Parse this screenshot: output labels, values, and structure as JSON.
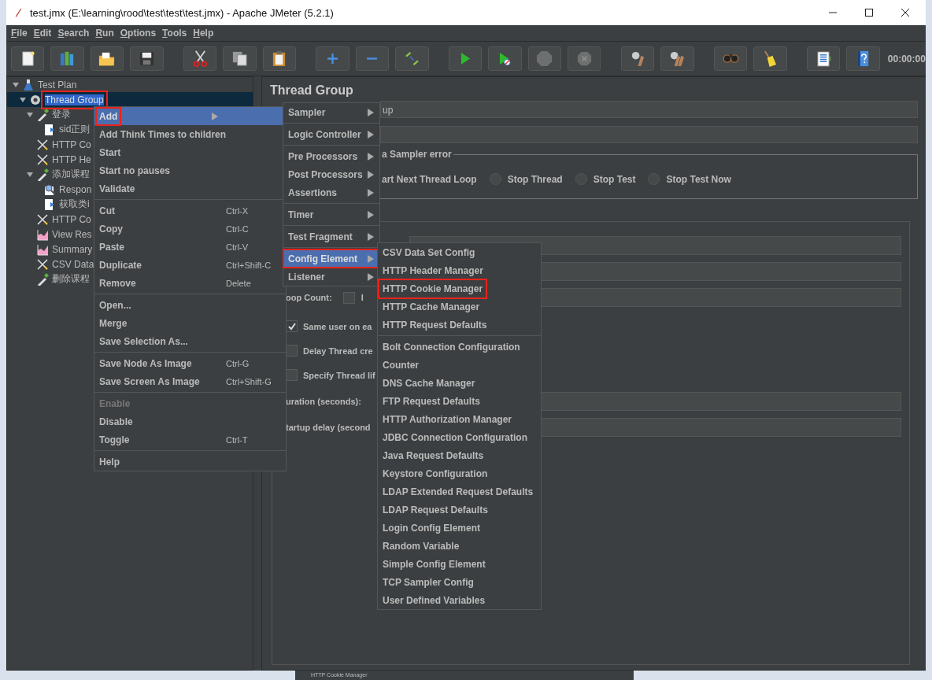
{
  "window": {
    "title": "test.jmx (E:\\learning\\rood\\test\\test\\test.jmx) - Apache JMeter (5.2.1)"
  },
  "menu_bar": [
    {
      "label": "File"
    },
    {
      "label": "Edit"
    },
    {
      "label": "Search"
    },
    {
      "label": "Run"
    },
    {
      "label": "Options"
    },
    {
      "label": "Tools"
    },
    {
      "label": "Help"
    }
  ],
  "toolbar": {
    "buttons": [
      {
        "kind": "new",
        "disabled": false,
        "separator_before": false
      },
      {
        "kind": "templates",
        "disabled": false,
        "separator_before": false
      },
      {
        "kind": "open",
        "disabled": false,
        "separator_before": false
      },
      {
        "kind": "save",
        "disabled": false,
        "separator_before": false
      },
      {
        "kind": "cut",
        "disabled": false,
        "separator_before": true
      },
      {
        "kind": "copy",
        "disabled": false,
        "separator_before": false
      },
      {
        "kind": "paste",
        "disabled": false,
        "separator_before": false
      },
      {
        "kind": "expand",
        "disabled": false,
        "separator_before": true
      },
      {
        "kind": "collapse",
        "disabled": false,
        "separator_before": false
      },
      {
        "kind": "toggle",
        "disabled": false,
        "separator_before": false
      },
      {
        "kind": "start",
        "disabled": false,
        "separator_before": true
      },
      {
        "kind": "start-no-pause",
        "disabled": false,
        "separator_before": false
      },
      {
        "kind": "stop",
        "disabled": true,
        "separator_before": false
      },
      {
        "kind": "shutdown",
        "disabled": true,
        "separator_before": false
      },
      {
        "kind": "clear",
        "disabled": false,
        "separator_before": true
      },
      {
        "kind": "clear-all",
        "disabled": false,
        "separator_before": false
      },
      {
        "kind": "search",
        "disabled": false,
        "separator_before": true
      },
      {
        "kind": "reset-search",
        "disabled": false,
        "separator_before": false
      },
      {
        "kind": "function-helper",
        "disabled": false,
        "separator_before": true
      },
      {
        "kind": "help",
        "disabled": false,
        "separator_before": false
      }
    ],
    "timer": "00:00:00"
  },
  "tree": [
    {
      "label": "Test Plan",
      "kind": "plan",
      "expanded": true,
      "selected": false,
      "outlined": false,
      "children": [
        {
          "label": "Thread Group",
          "kind": "group",
          "expanded": true,
          "selected": true,
          "outlined": true,
          "children": [
            {
              "label": "登录",
              "kind": "sampler",
              "expanded": true,
              "selected": false,
              "outlined": false,
              "children": [
                {
                  "label": "sid正则",
                  "kind": "extractor",
                  "selected": false,
                  "outlined": false
                }
              ]
            },
            {
              "label": "HTTP Co",
              "kind": "config",
              "selected": false,
              "outlined": false
            },
            {
              "label": "HTTP He",
              "kind": "config",
              "selected": false,
              "outlined": false
            },
            {
              "label": "添加课程",
              "kind": "sampler",
              "expanded": true,
              "selected": false,
              "outlined": false,
              "children": [
                {
                  "label": "Respon",
                  "kind": "assertion",
                  "selected": false,
                  "outlined": false
                },
                {
                  "label": "获取类i",
                  "kind": "extractor",
                  "selected": false,
                  "outlined": false
                }
              ]
            },
            {
              "label": "HTTP Co",
              "kind": "config",
              "selected": false,
              "outlined": false
            },
            {
              "label": "View Res",
              "kind": "listener",
              "selected": false,
              "outlined": false
            },
            {
              "label": "Summary",
              "kind": "listener",
              "selected": false,
              "outlined": false
            },
            {
              "label": "CSV Data",
              "kind": "config",
              "selected": false,
              "outlined": false
            },
            {
              "label": "删除课程",
              "kind": "sampler",
              "selected": false,
              "outlined": false
            }
          ]
        }
      ]
    }
  ],
  "editor": {
    "title": "Thread Group",
    "name_value": "up",
    "error_group": {
      "legend": "a Sampler error",
      "partial_option": "art Next Thread Loop",
      "options": [
        {
          "label": "Stop Thread",
          "selected": false
        },
        {
          "label": "Stop Test",
          "selected": false
        },
        {
          "label": "Stop Test Now",
          "selected": false
        }
      ]
    },
    "loop_label": "oop Count:",
    "infinite": {
      "label": "I",
      "checked": false
    },
    "checkboxes": [
      {
        "label": "Same user on ea",
        "checked": true
      },
      {
        "label": "Delay Thread cre",
        "checked": false
      },
      {
        "label": "Specify Thread lif",
        "checked": false
      }
    ],
    "duration_label": "uration (seconds):",
    "startup_label": "tartup delay (second"
  },
  "context_menu": {
    "sections": [
      [
        {
          "label": "Add",
          "has_submenu": true,
          "selected": true,
          "disabled": false,
          "outlined": true
        },
        {
          "label": "Add Think Times to children",
          "has_submenu": false,
          "selected": false,
          "disabled": false,
          "outlined": false
        },
        {
          "label": "Start",
          "has_submenu": false,
          "selected": false,
          "disabled": false,
          "outlined": false
        },
        {
          "label": "Start no pauses",
          "has_submenu": false,
          "selected": false,
          "disabled": false,
          "outlined": false
        },
        {
          "label": "Validate",
          "has_submenu": false,
          "selected": false,
          "disabled": false,
          "outlined": false
        }
      ],
      [
        {
          "label": "Cut",
          "shortcut": "Ctrl-X",
          "has_submenu": false,
          "selected": false,
          "disabled": false,
          "outlined": false
        },
        {
          "label": "Copy",
          "shortcut": "Ctrl-C",
          "has_submenu": false,
          "selected": false,
          "disabled": false,
          "outlined": false
        },
        {
          "label": "Paste",
          "shortcut": "Ctrl-V",
          "has_submenu": false,
          "selected": false,
          "disabled": false,
          "outlined": false
        },
        {
          "label": "Duplicate",
          "shortcut": "Ctrl+Shift-C",
          "has_submenu": false,
          "selected": false,
          "disabled": false,
          "outlined": false
        },
        {
          "label": "Remove",
          "shortcut": "Delete",
          "has_submenu": false,
          "selected": false,
          "disabled": false,
          "outlined": false
        }
      ],
      [
        {
          "label": "Open...",
          "has_submenu": false,
          "selected": false,
          "disabled": false,
          "outlined": false
        },
        {
          "label": "Merge",
          "has_submenu": false,
          "selected": false,
          "disabled": false,
          "outlined": false
        },
        {
          "label": "Save Selection As...",
          "has_submenu": false,
          "selected": false,
          "disabled": false,
          "outlined": false
        }
      ],
      [
        {
          "label": "Save Node As Image",
          "shortcut": "Ctrl-G",
          "has_submenu": false,
          "selected": false,
          "disabled": false,
          "outlined": false
        },
        {
          "label": "Save Screen As Image",
          "shortcut": "Ctrl+Shift-G",
          "has_submenu": false,
          "selected": false,
          "disabled": false,
          "outlined": false
        }
      ],
      [
        {
          "label": "Enable",
          "has_submenu": false,
          "selected": false,
          "disabled": true,
          "outlined": false
        },
        {
          "label": "Disable",
          "has_submenu": false,
          "selected": false,
          "disabled": false,
          "outlined": false
        },
        {
          "label": "Toggle",
          "shortcut": "Ctrl-T",
          "has_submenu": false,
          "selected": false,
          "disabled": false,
          "outlined": false
        }
      ],
      [
        {
          "label": "Help",
          "has_submenu": false,
          "selected": false,
          "disabled": false,
          "outlined": false
        }
      ]
    ]
  },
  "add_submenu": {
    "sections": [
      [
        {
          "label": "Sampler",
          "has_submenu": true,
          "selected": false,
          "outlined": false
        }
      ],
      [
        {
          "label": "Logic Controller",
          "has_submenu": true,
          "selected": false,
          "outlined": false
        }
      ],
      [
        {
          "label": "Pre Processors",
          "has_submenu": true,
          "selected": false,
          "outlined": false
        },
        {
          "label": "Post Processors",
          "has_submenu": true,
          "selected": false,
          "outlined": false
        },
        {
          "label": "Assertions",
          "has_submenu": true,
          "selected": false,
          "outlined": false
        }
      ],
      [
        {
          "label": "Timer",
          "has_submenu": true,
          "selected": false,
          "outlined": false
        }
      ],
      [
        {
          "label": "Test Fragment",
          "has_submenu": true,
          "selected": false,
          "outlined": false
        }
      ],
      [
        {
          "label": "Config Element",
          "has_submenu": true,
          "selected": true,
          "outlined": true
        },
        {
          "label": "Listener",
          "has_submenu": true,
          "selected": false,
          "outlined": false
        }
      ]
    ]
  },
  "config_submenu": {
    "sections": [
      [
        {
          "label": "CSV Data Set Config",
          "selected": false,
          "outlined": false
        },
        {
          "label": "HTTP Header Manager",
          "selected": false,
          "outlined": false
        },
        {
          "label": "HTTP Cookie Manager",
          "selected": false,
          "outlined": true
        },
        {
          "label": "HTTP Cache Manager",
          "selected": false,
          "outlined": false
        },
        {
          "label": "HTTP Request Defaults",
          "selected": false,
          "outlined": false
        }
      ],
      [
        {
          "label": "Bolt Connection Configuration",
          "selected": false,
          "outlined": false
        },
        {
          "label": "Counter",
          "selected": false,
          "outlined": false
        },
        {
          "label": "DNS Cache Manager",
          "selected": false,
          "outlined": false
        },
        {
          "label": "FTP Request Defaults",
          "selected": false,
          "outlined": false
        },
        {
          "label": "HTTP Authorization Manager",
          "selected": false,
          "outlined": false
        },
        {
          "label": "JDBC Connection Configuration",
          "selected": false,
          "outlined": false
        },
        {
          "label": "Java Request Defaults",
          "selected": false,
          "outlined": false
        },
        {
          "label": "Keystore Configuration",
          "selected": false,
          "outlined": false
        },
        {
          "label": "LDAP Extended Request Defaults",
          "selected": false,
          "outlined": false
        },
        {
          "label": "LDAP Request Defaults",
          "selected": false,
          "outlined": false
        },
        {
          "label": "Login Config Element",
          "selected": false,
          "outlined": false
        },
        {
          "label": "Random Variable",
          "selected": false,
          "outlined": false
        },
        {
          "label": "Simple Config Element",
          "selected": false,
          "outlined": false
        },
        {
          "label": "TCP Sampler Config",
          "selected": false,
          "outlined": false
        },
        {
          "label": "User Defined Variables",
          "selected": false,
          "outlined": false
        }
      ]
    ]
  },
  "background_window": {
    "label": "HTTP Cookie Manager"
  }
}
